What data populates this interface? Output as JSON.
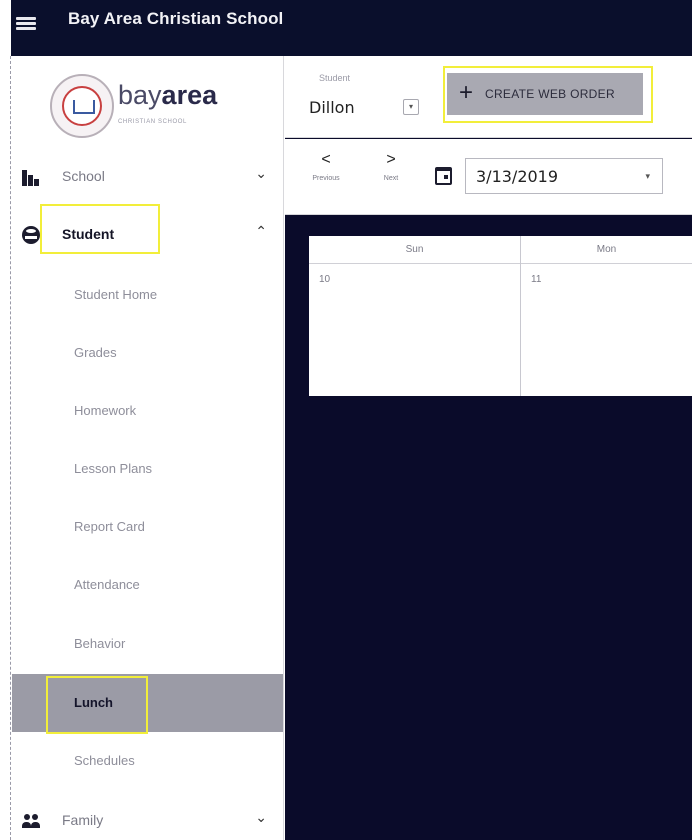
{
  "app": {
    "title": "Bay Area Christian School"
  },
  "logo": {
    "text_regular": "bay",
    "text_bold": "area",
    "subtitle": "CHRISTIAN SCHOOL"
  },
  "sidebar": {
    "items": [
      {
        "label": "School",
        "icon": "school-icon",
        "chevron": "⌄"
      },
      {
        "label": "Student",
        "icon": "student-icon",
        "chevron": "⌃"
      },
      {
        "label": "Family",
        "icon": "family-icon",
        "chevron": "⌄"
      }
    ],
    "student_subitems": [
      {
        "label": "Student Home"
      },
      {
        "label": "Grades"
      },
      {
        "label": "Homework"
      },
      {
        "label": "Lesson Plans"
      },
      {
        "label": "Report Card"
      },
      {
        "label": "Attendance"
      },
      {
        "label": "Behavior"
      },
      {
        "label": "Lunch",
        "active": true
      },
      {
        "label": "Schedules"
      }
    ]
  },
  "toolbar": {
    "student_label": "Student",
    "student_value": "Dillon",
    "create_order_label": "CREATE WEB ORDER"
  },
  "date_nav": {
    "previous_label": "Previous",
    "next_label": "Next",
    "date_value": "3/13/2019"
  },
  "calendar": {
    "days": [
      {
        "name": "Sun",
        "date": "10"
      },
      {
        "name": "Mon",
        "date": "11"
      }
    ]
  },
  "colors": {
    "topbar": "#0a0f2c",
    "main_background": "#0a0b2a",
    "highlight": "#f2ee3a",
    "active_item": "#9b9ba6"
  }
}
